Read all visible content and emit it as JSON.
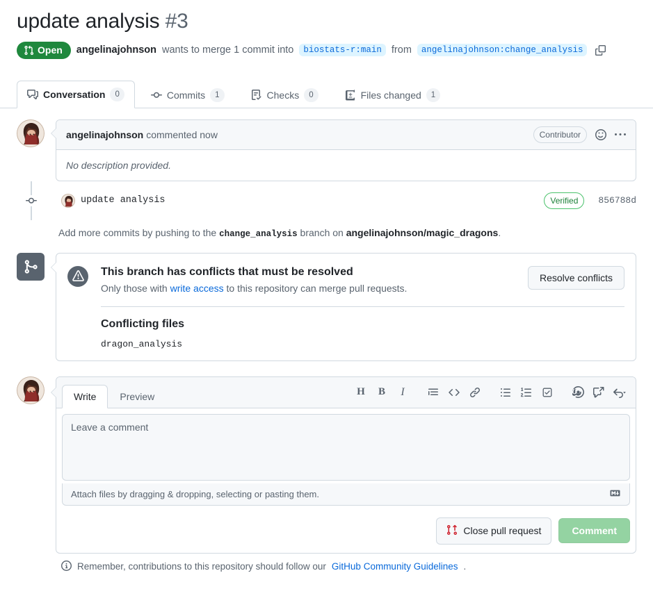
{
  "header": {
    "title": "update analysis",
    "number": "#3",
    "state": "Open",
    "author": "angelinajohnson",
    "merge_phrase": "wants to merge 1 commit into",
    "base_branch": "biostats-r:main",
    "from_word": "from",
    "head_branch": "angelinajohnson:change_analysis"
  },
  "tabs": [
    {
      "label": "Conversation",
      "count": "0",
      "icon": "comment-discussion-icon",
      "active": true
    },
    {
      "label": "Commits",
      "count": "1",
      "icon": "git-commit-icon",
      "active": false
    },
    {
      "label": "Checks",
      "count": "0",
      "icon": "checklist-icon",
      "active": false
    },
    {
      "label": "Files changed",
      "count": "1",
      "icon": "file-diff-icon",
      "active": false
    }
  ],
  "comment": {
    "author": "angelinajohnson",
    "action": "commented now",
    "role": "Contributor",
    "body": "No description provided."
  },
  "commit": {
    "message": "update analysis",
    "verified": "Verified",
    "sha": "856788d"
  },
  "push_note": {
    "prefix": "Add more commits by pushing to the",
    "branch": "change_analysis",
    "middle": "branch on",
    "repo": "angelinajohnson/magic_dragons",
    "suffix": "."
  },
  "merge": {
    "conflict_title": "This branch has conflicts that must be resolved",
    "conflict_sub_prefix": "Only those with",
    "conflict_sub_link": "write access",
    "conflict_sub_suffix": "to this repository can merge pull requests.",
    "resolve_button": "Resolve conflicts",
    "files_title": "Conflicting files",
    "files": [
      "dragon_analysis"
    ]
  },
  "form": {
    "write_tab": "Write",
    "preview_tab": "Preview",
    "placeholder": "Leave a comment",
    "attach_hint": "Attach files by dragging & dropping, selecting or pasting them.",
    "close_button": "Close pull request",
    "comment_button": "Comment",
    "toolbar": [
      "heading-icon",
      "bold-icon",
      "italic-icon",
      "quote-icon",
      "code-icon",
      "link-icon",
      "unordered-list-icon",
      "ordered-list-icon",
      "task-list-icon",
      "mention-icon",
      "reference-icon",
      "reply-icon"
    ]
  },
  "footer": {
    "text_prefix": "Remember, contributions to this repository should follow our",
    "link": "GitHub Community Guidelines",
    "text_suffix": "."
  },
  "colors": {
    "open_green": "#1f883d",
    "link_blue": "#0969da",
    "verified_green": "#1a7f37",
    "branch_bg": "#ddf4ff",
    "border": "#d1d9e0"
  }
}
